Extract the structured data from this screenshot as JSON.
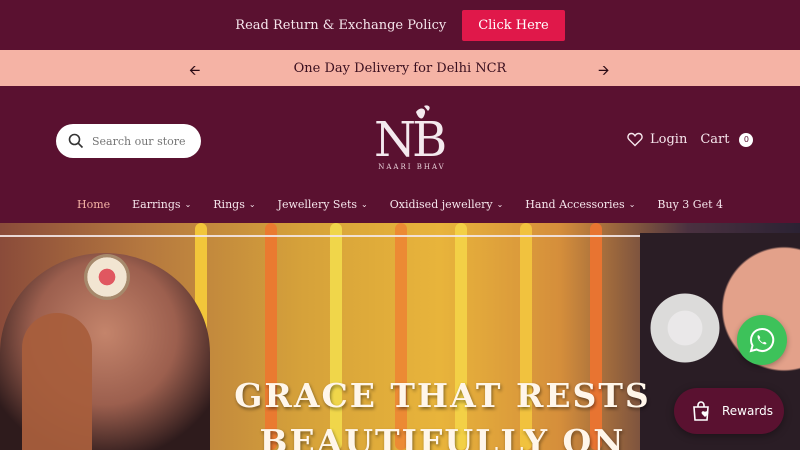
{
  "topbar": {
    "text": "Read Return & Exchange Policy",
    "button": "Click Here"
  },
  "announcement": {
    "text": "One Day Delivery for Delhi NCR"
  },
  "header": {
    "search_placeholder": "Search our store",
    "logo_subtitle": "NAARI BHAV",
    "login": "Login",
    "cart": "Cart",
    "cart_count": "0"
  },
  "nav": [
    {
      "label": "Home",
      "dropdown": false
    },
    {
      "label": "Earrings",
      "dropdown": true
    },
    {
      "label": "Rings",
      "dropdown": true
    },
    {
      "label": "Jewellery Sets",
      "dropdown": true
    },
    {
      "label": "Oxidised jewellery",
      "dropdown": true
    },
    {
      "label": "Hand Accessories",
      "dropdown": true
    },
    {
      "label": "Buy 3 Get 4",
      "dropdown": false
    }
  ],
  "hero": {
    "title_line1": "GRACE THAT RESTS",
    "title_line2": "BEAUTIFULLY ON"
  },
  "rewards": {
    "label": "Rewards"
  },
  "colors": {
    "brand": "#5a1130",
    "accent": "#e0184a",
    "announcement_bg": "#f5b3a5",
    "whatsapp": "#3dc25a"
  },
  "icons": [
    "arrow-left-icon",
    "arrow-right-icon",
    "search-icon",
    "heart-icon",
    "chevron-down-icon",
    "whatsapp-icon",
    "gift-bag-icon"
  ]
}
